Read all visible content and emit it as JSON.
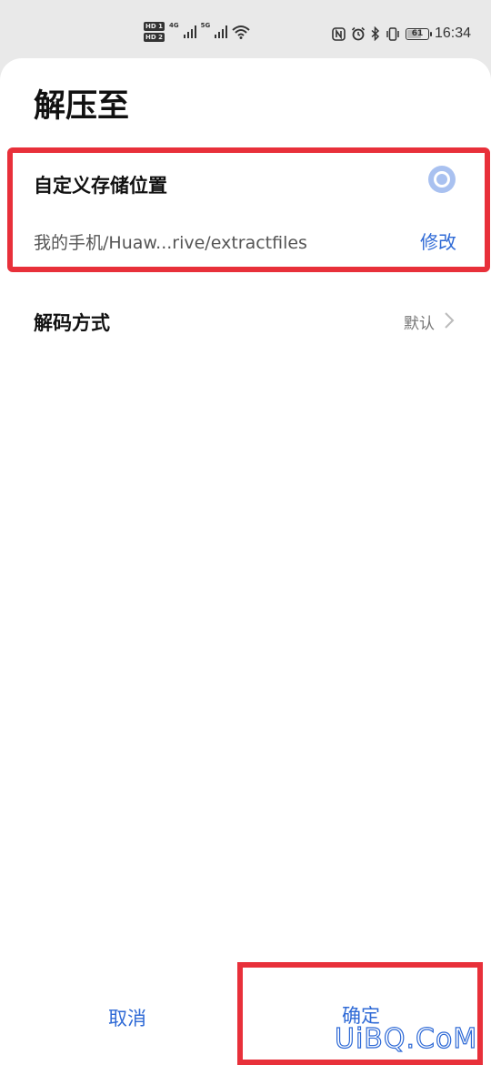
{
  "status_bar": {
    "hd1": "HD 1",
    "hd2": "HD 2",
    "net1": "4G",
    "net2": "5G",
    "battery": "61",
    "time": "16:34",
    "icons": [
      "hd-icon",
      "signal-icon",
      "wifi-icon",
      "nfc-icon",
      "alarm-icon",
      "bluetooth-icon",
      "vibrate-icon",
      "battery-icon"
    ]
  },
  "dialog": {
    "title": "解压至",
    "custom_option": {
      "label": "自定义存储位置",
      "path": "我的手机/Huaw...rive/extractfiles",
      "modify_label": "修改",
      "selected": true
    },
    "decode": {
      "label": "解码方式",
      "value": "默认"
    },
    "buttons": {
      "cancel": "取消",
      "confirm": "确定"
    }
  },
  "watermark": "UiBQ.CoM",
  "colors": {
    "accent": "#2f6ad6",
    "highlight": "#e8303a",
    "radio": "#a9c1f0"
  }
}
